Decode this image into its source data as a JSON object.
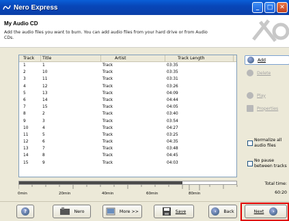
{
  "window": {
    "title": "Nero Express"
  },
  "header": {
    "title": "My Audio CD",
    "description": "Add the audio files you want to burn. You can add audio files from your hard drive or from Audio CDs."
  },
  "columns": [
    "Track",
    "Title",
    "Artist",
    "Track Length"
  ],
  "tracks": [
    {
      "track": "1",
      "title": "1",
      "artist": "Track",
      "length": "03:35"
    },
    {
      "track": "2",
      "title": "10",
      "artist": "Track",
      "length": "03:35"
    },
    {
      "track": "3",
      "title": "11",
      "artist": "Track",
      "length": "03:31"
    },
    {
      "track": "4",
      "title": "12",
      "artist": "Track",
      "length": "03:26"
    },
    {
      "track": "5",
      "title": "13",
      "artist": "Track",
      "length": "04:09"
    },
    {
      "track": "6",
      "title": "14",
      "artist": "Track",
      "length": "04:44"
    },
    {
      "track": "7",
      "title": "15",
      "artist": "Track",
      "length": "04:05"
    },
    {
      "track": "8",
      "title": "2",
      "artist": "Track",
      "length": "03:40"
    },
    {
      "track": "9",
      "title": "3",
      "artist": "Track",
      "length": "03:54"
    },
    {
      "track": "10",
      "title": "4",
      "artist": "Track",
      "length": "04:27"
    },
    {
      "track": "11",
      "title": "5",
      "artist": "Track",
      "length": "03:25"
    },
    {
      "track": "12",
      "title": "6",
      "artist": "Track",
      "length": "04:35"
    },
    {
      "track": "13",
      "title": "7",
      "artist": "Track",
      "length": "03:48"
    },
    {
      "track": "14",
      "title": "8",
      "artist": "Track",
      "length": "04:45"
    },
    {
      "track": "15",
      "title": "9",
      "artist": "Track",
      "length": "04:03"
    }
  ],
  "side_buttons": {
    "add": "Add",
    "delete": "Delete",
    "play": "Play",
    "properties": "Properties"
  },
  "options": {
    "normalize": "Normalize all audio files",
    "no_pause": "No pause between tracks"
  },
  "total": {
    "label": "Total time:",
    "value": "60:20"
  },
  "timeline": {
    "labels": [
      "0min",
      "20min",
      "40min",
      "60min",
      "80min"
    ],
    "fill_fraction": 0.75
  },
  "bottom": {
    "help": "?",
    "nero": "Nero",
    "more": "More >>",
    "save": "Save",
    "back": "Back",
    "next": "Next"
  },
  "colors": {
    "highlight": "#e00000",
    "title_bar": "#0a5fd8"
  }
}
